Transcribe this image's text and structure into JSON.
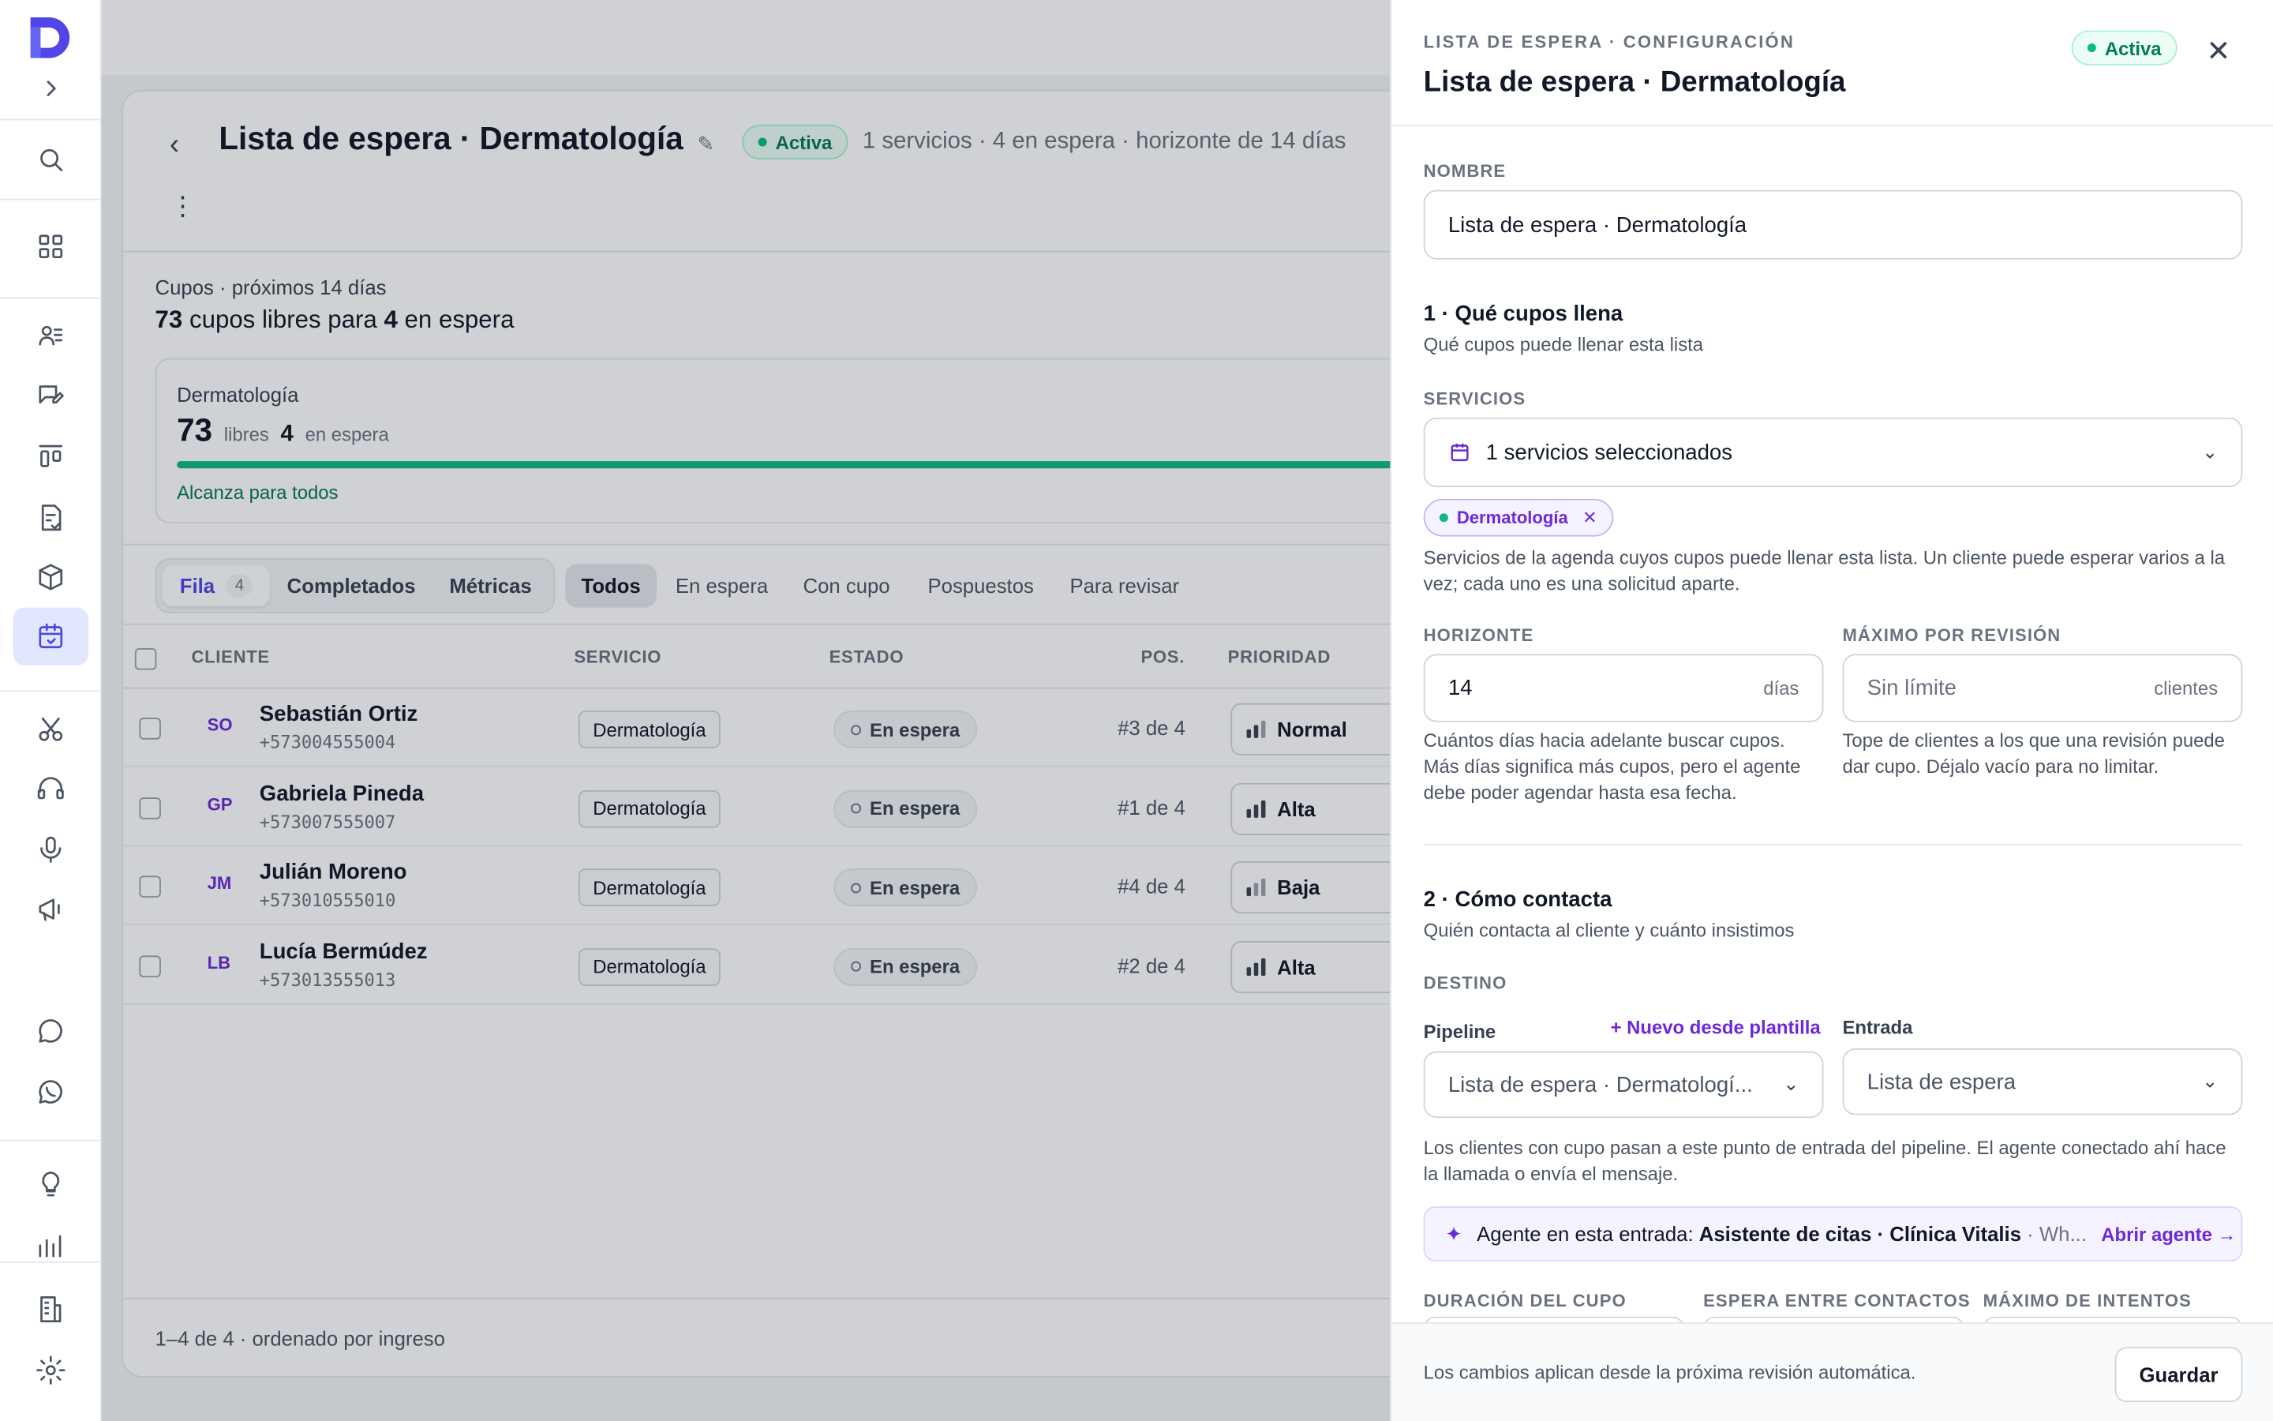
{
  "header": {
    "title": "Lista de espera · Dermatología",
    "status": "Activa",
    "meta": "1 servicios · 4 en espera · horizonte de 14 días"
  },
  "cupos": {
    "label": "Cupos · próximos 14 días",
    "free": "73",
    "free_text": "cupos libres para",
    "waiting": "4",
    "waiting_text": "en espera",
    "card": {
      "name": "Dermatología",
      "free": "73",
      "free_lbl": "libres",
      "waiting": "4",
      "waiting_lbl": "en espera",
      "coverage": 1.0,
      "note": "Alcanza para todos"
    }
  },
  "tabs": {
    "fila": "Fila",
    "fila_count": "4",
    "completados": "Completados",
    "metricas": "Métricas"
  },
  "filters": [
    "Todos",
    "En espera",
    "Con cupo",
    "Pospuestos",
    "Para revisar"
  ],
  "table": {
    "headers": {
      "cliente": "CLIENTE",
      "servicio": "SERVICIO",
      "estado": "ESTADO",
      "pos": "POS.",
      "prioridad": "PRIORIDAD"
    },
    "rows": [
      {
        "initials": "SO",
        "name": "Sebastián Ortiz",
        "phone": "+573004555004",
        "service": "Dermatología",
        "status": "En espera",
        "pos": "#3 de 4",
        "priority": "Normal"
      },
      {
        "initials": "GP",
        "name": "Gabriela Pineda",
        "phone": "+573007555007",
        "service": "Dermatología",
        "status": "En espera",
        "pos": "#1 de 4",
        "priority": "Alta"
      },
      {
        "initials": "JM",
        "name": "Julián Moreno",
        "phone": "+573010555010",
        "service": "Dermatología",
        "status": "En espera",
        "pos": "#4 de 4",
        "priority": "Baja"
      },
      {
        "initials": "LB",
        "name": "Lucía Bermúdez",
        "phone": "+573013555013",
        "service": "Dermatología",
        "status": "En espera",
        "pos": "#2 de 4",
        "priority": "Alta"
      }
    ],
    "footer": "1–4 de 4 · ordenado por ingreso"
  },
  "panel": {
    "kicker": "LISTA DE ESPERA · CONFIGURACIÓN",
    "title": "Lista de espera · Dermatología",
    "status": "Activa",
    "nombre_lbl": "NOMBRE",
    "nombre_val": "Lista de espera · Dermatología",
    "s1_title": "1 · Qué cupos llena",
    "s1_sub": "Qué cupos puede llenar esta lista",
    "servicios_lbl": "SERVICIOS",
    "servicios_val": "1 servicios seleccionados",
    "chip": "Dermatología",
    "servicios_help": "Servicios de la agenda cuyos cupos puede llenar esta lista. Un cliente puede esperar varios a la vez; cada uno es una solicitud aparte.",
    "horizonte_lbl": "HORIZONTE",
    "horizonte_val": "14",
    "horizonte_suf": "días",
    "horizonte_help": "Cuántos días hacia adelante buscar cupos. Más días significa más cupos, pero el agente debe poder agendar hasta esa fecha.",
    "max_lbl": "MÁXIMO POR REVISIÓN",
    "max_ph": "Sin límite",
    "max_suf": "clientes",
    "max_help": "Tope de clientes a los que una revisión puede dar cupo. Déjalo vacío para no limitar.",
    "s2_title": "2 · Cómo contacta",
    "s2_sub": "Quién contacta al cliente y cuánto insistimos",
    "destino_lbl": "DESTINO",
    "pipeline_lbl": "Pipeline",
    "nuevo_link": "+ Nuevo desde plantilla",
    "pipeline_val": "Lista de espera · Dermatologí...",
    "entrada_lbl": "Entrada",
    "entrada_val": "Lista de espera",
    "destino_help": "Los clientes con cupo pasan a este punto de entrada del pipeline. El agente conectado ahí hace la llamada o envía el mensaje.",
    "agent_pre": "Agente en esta entrada:",
    "agent_name": "Asistente de citas · Clínica Vitalis",
    "agent_rest": "· Wh...",
    "agent_open": "Abrir agente →",
    "dur_lbl": "DURACIÓN DEL CUPO",
    "espera_lbl": "ESPERA ENTRE CONTACTOS",
    "intentos_lbl": "MÁXIMO DE INTENTOS",
    "footer_text": "Los cambios aplican desde la próxima revisión automática.",
    "save": "Guardar"
  },
  "icons": [
    "logo",
    "expand-icon",
    "search-icon",
    "grid-icon",
    "contacts-icon",
    "chat-edit-icon",
    "kanban-icon",
    "checklist-icon",
    "boxes-icon",
    "calendar-icon",
    "scissors-icon",
    "headset-icon",
    "microphone-icon",
    "megaphone-icon",
    "message-icon",
    "whatsapp-icon",
    "lightbulb-icon",
    "analytics-icon",
    "building-icon",
    "gear-icon"
  ],
  "colors": {
    "accent": "#4f46e5",
    "purple": "#6d28d9",
    "green": "#10b981"
  }
}
